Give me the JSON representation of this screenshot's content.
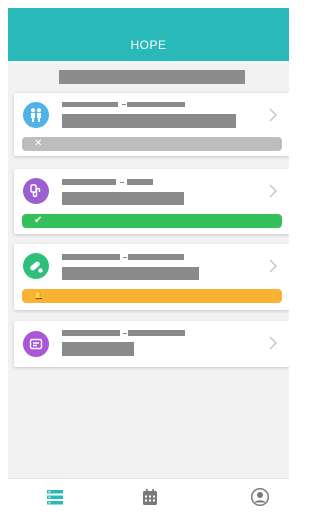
{
  "app": {
    "title": "HOPE"
  },
  "cards": [
    {
      "icon": "family-icon",
      "icon_color": "#4fb2e8",
      "status_symbol": "✕",
      "status_color": "#bdbdbd"
    },
    {
      "icon": "drip-icon",
      "icon_color": "#9b5fd0",
      "status_symbol": "✔",
      "status_color": "#33c05a"
    },
    {
      "icon": "pills-icon",
      "icon_color": "#2ec07a",
      "status_symbol": "🔔",
      "status_color": "#f9b233"
    },
    {
      "icon": "message-icon",
      "icon_color": "#a855d8"
    }
  ],
  "tabs": [
    {
      "icon": "list-icon",
      "active": true,
      "color": "#29b9b9"
    },
    {
      "icon": "calendar-icon",
      "active": false,
      "color": "#7a7a7a"
    },
    {
      "icon": "profile-icon",
      "active": false,
      "color": "#7a7a7a"
    }
  ]
}
